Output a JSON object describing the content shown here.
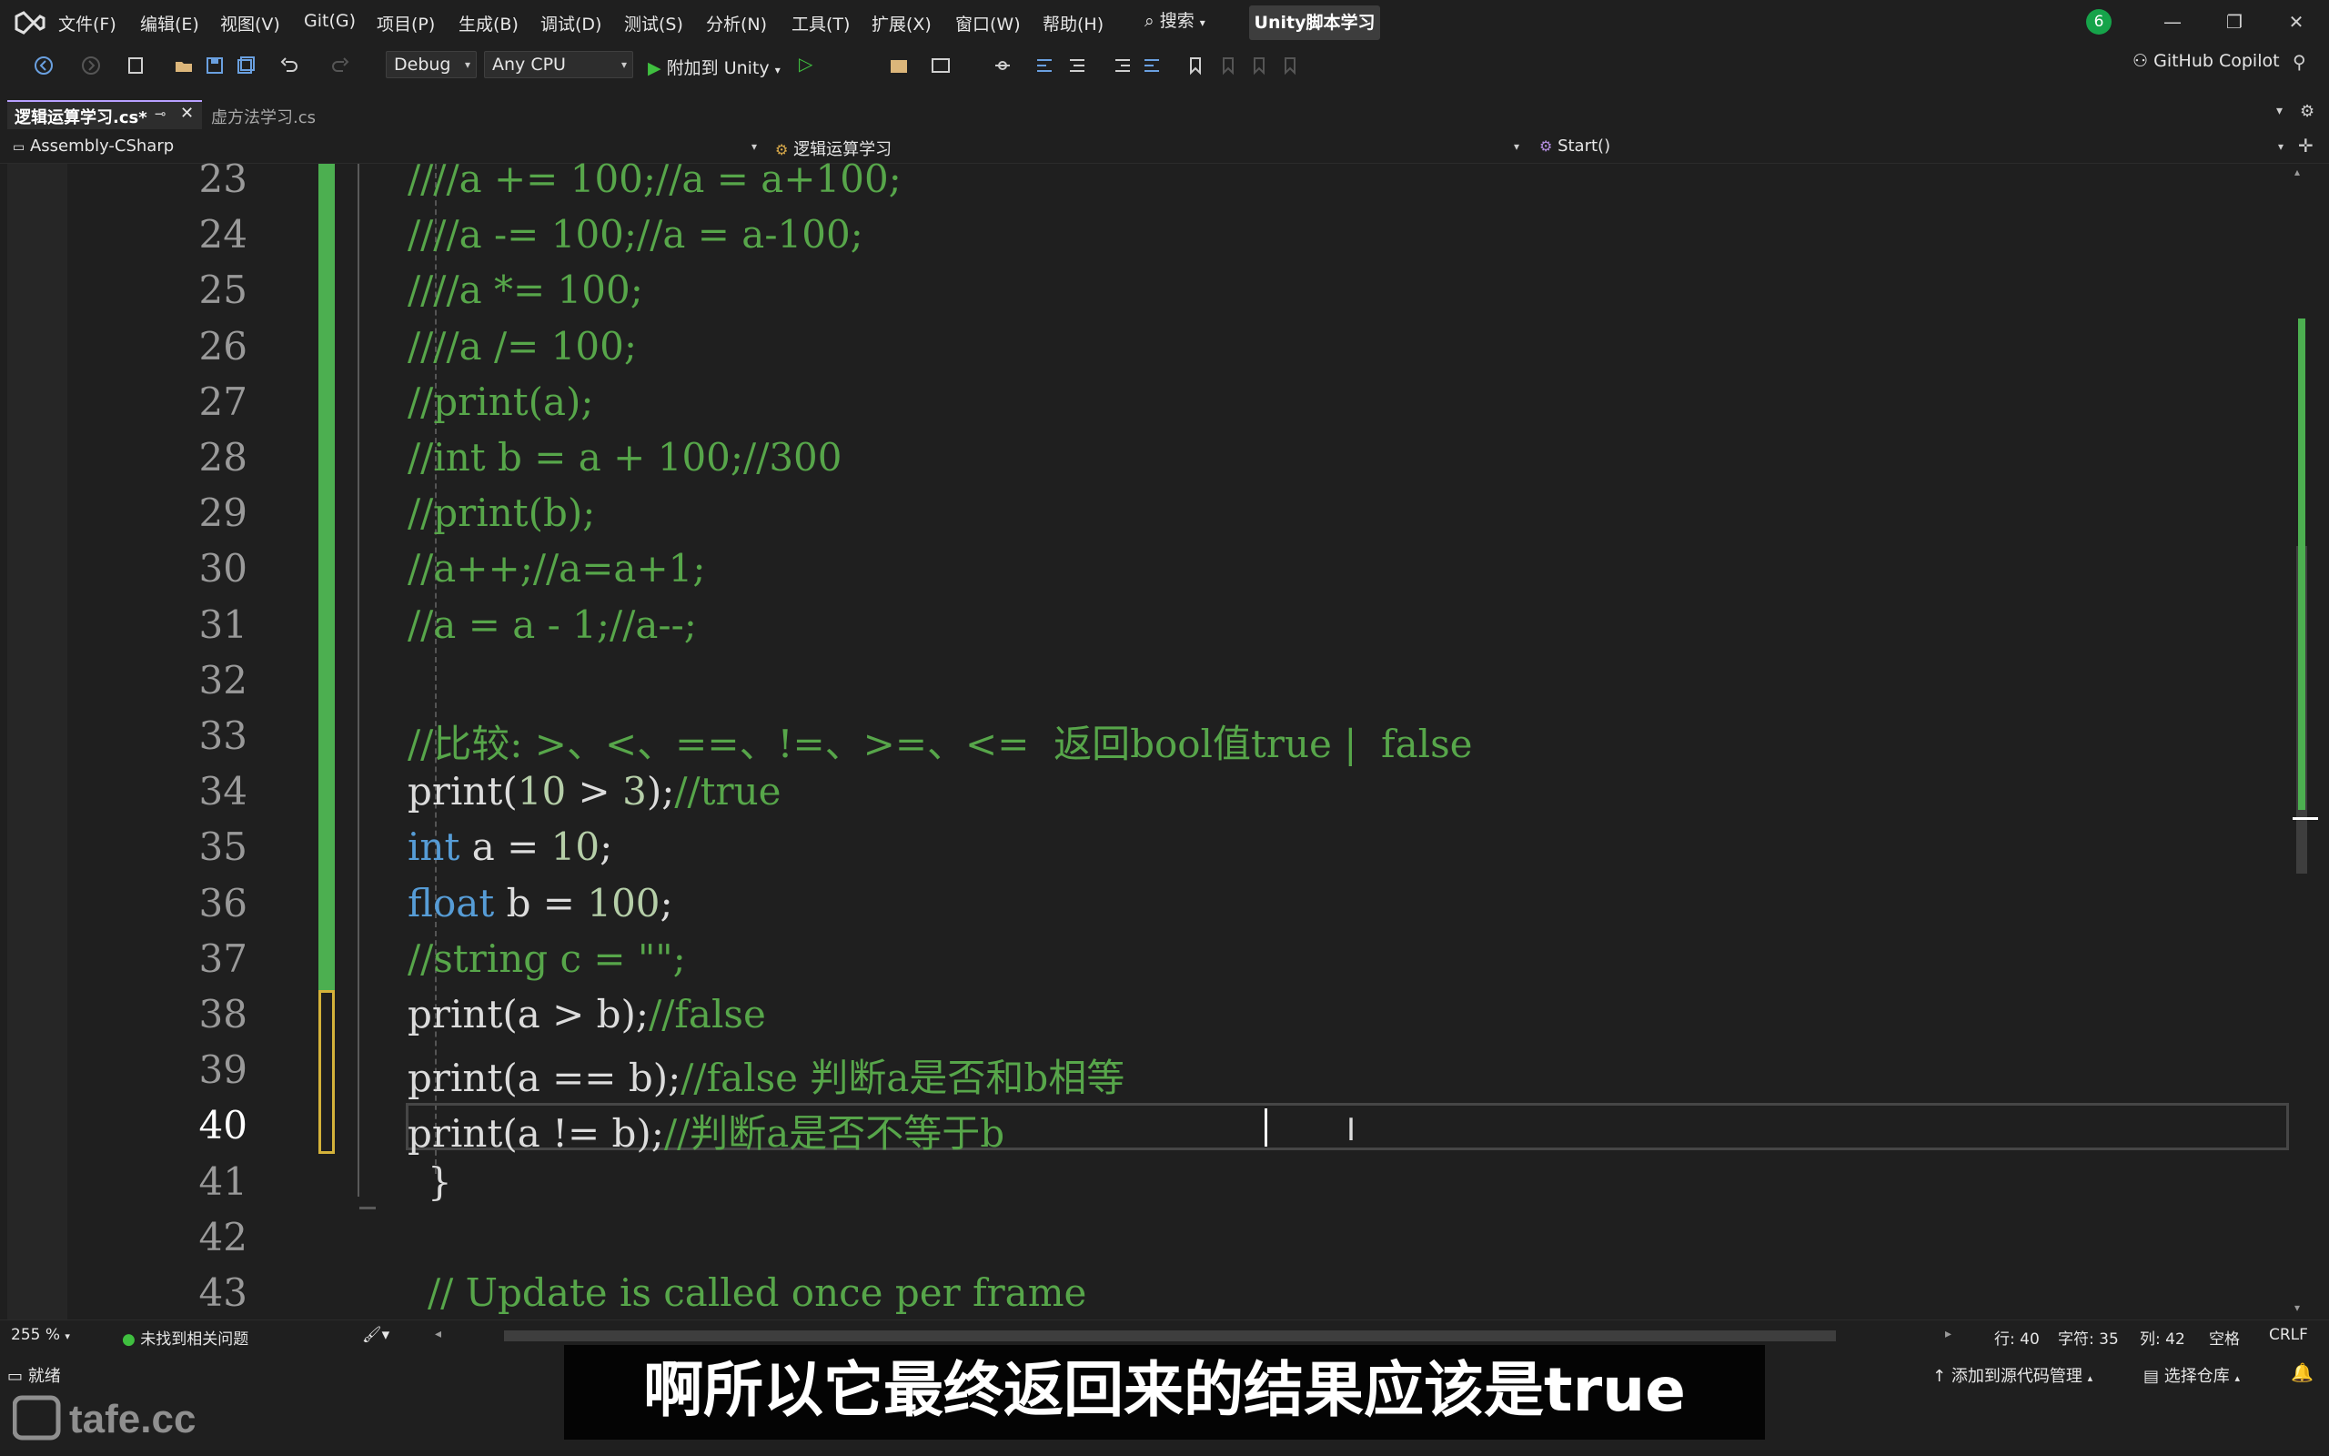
{
  "menu": {
    "items": [
      "文件(F)",
      "编辑(E)",
      "视图(V)",
      "Git(G)",
      "项目(P)",
      "生成(B)",
      "调试(D)",
      "测试(S)",
      "分析(N)",
      "工具(T)",
      "扩展(X)",
      "窗口(W)",
      "帮助(H)"
    ],
    "search_label": "搜索",
    "solution_name": "Unity脚本学习",
    "notification_count": "6"
  },
  "toolbar": {
    "config": "Debug",
    "platform": "Any CPU",
    "attach_label": "附加到 Unity",
    "copilot_label": "GitHub Copilot"
  },
  "tabs": {
    "active": "逻辑运算学习.cs*",
    "inactive": "虚方法学习.cs"
  },
  "navbar": {
    "project": "Assembly-CSharp",
    "type": "逻辑运算学习",
    "member": "Start()"
  },
  "editor": {
    "lines": [
      {
        "num": "23",
        "text": "////a += 100;//a = a+100;"
      },
      {
        "num": "24",
        "text": "////a -= 100;//a = a-100;"
      },
      {
        "num": "25",
        "text": "////a *= 100;"
      },
      {
        "num": "26",
        "text": "////a /= 100;"
      },
      {
        "num": "27",
        "text": "//print(a);"
      },
      {
        "num": "28",
        "text": "//int b = a + 100;//300"
      },
      {
        "num": "29",
        "text": "//print(b);"
      },
      {
        "num": "30",
        "text": "//a++;//a=a+1;"
      },
      {
        "num": "31",
        "text": "//a = a - 1;//a--;"
      },
      {
        "num": "32",
        "text": ""
      },
      {
        "num": "33",
        "text": "//比较: >、<、==、!=、>=、<=  返回bool值true |  false"
      },
      {
        "num": "34",
        "text": "print(10 > 3);//true"
      },
      {
        "num": "35",
        "text": "int a = 10;"
      },
      {
        "num": "36",
        "text": "float b = 100;"
      },
      {
        "num": "37",
        "text": "//string c = \"\";"
      },
      {
        "num": "38",
        "text": "print(a > b);//false"
      },
      {
        "num": "39",
        "text": "print(a == b);//false 判断a是否和b相等"
      },
      {
        "num": "40",
        "text": "print(a != b);//判断a是否不等于b "
      },
      {
        "num": "41",
        "text": "}"
      },
      {
        "num": "42",
        "text": ""
      },
      {
        "num": "43",
        "text": "// Update is called once per frame"
      }
    ],
    "colors": {
      "comment": "#57a64a",
      "keyword": "#569cd6",
      "default": "#dcdcdc",
      "change_saved": "#4caf50",
      "change_unsaved": "#d4b23a"
    }
  },
  "edit_status": {
    "zoom": "255 %",
    "issues": "未找到相关问题",
    "line": "行: 40",
    "char": "字符: 35",
    "col": "列: 42",
    "whitespace": "空格",
    "eol": "CRLF"
  },
  "statusbar": {
    "ready": "就绪",
    "add_source": "添加到源代码管理",
    "select_repo": "选择仓库"
  },
  "subtitle": "啊所以它最终返回来的结果应该是true",
  "watermark": "tafe.cc"
}
